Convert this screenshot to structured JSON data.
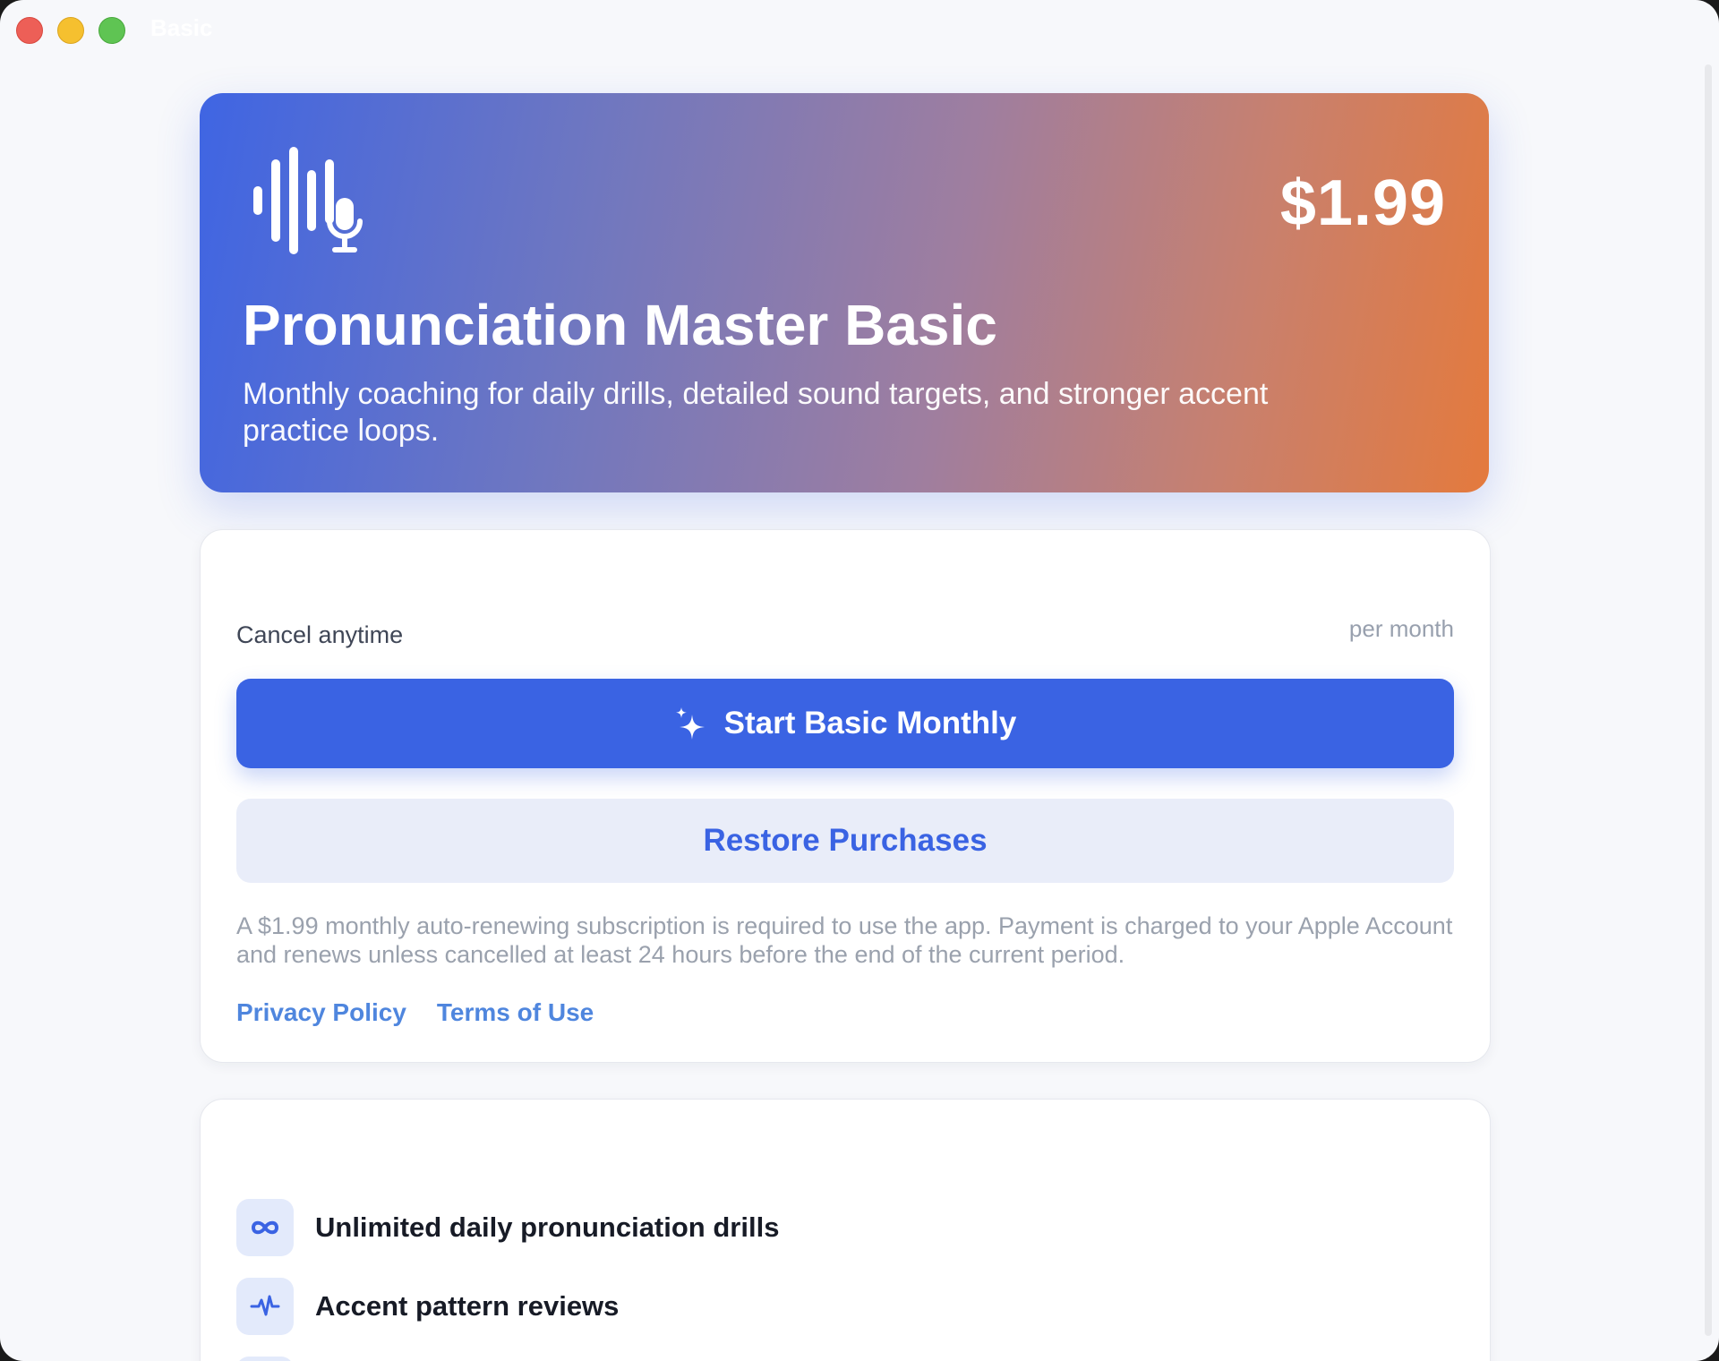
{
  "window": {
    "title": "Basic"
  },
  "hero": {
    "price": "$1.99",
    "title": "Pronunciation Master Basic",
    "subtitle": "Monthly coaching for daily drills, detailed sound targets, and stronger accent practice loops.",
    "logo_icon": "waveform-mic-icon"
  },
  "purchase": {
    "cancel_note": "Cancel anytime",
    "period": "per month",
    "primary_button": "Start Basic Monthly",
    "primary_icon": "sparkles-icon",
    "secondary_button": "Restore Purchases",
    "fine_print": "A $1.99 monthly auto-renewing subscription is required to use the app. Payment is charged to your Apple Account and renews unless cancelled at least 24 hours before the end of the current period.",
    "links": {
      "privacy": "Privacy Policy",
      "terms": "Terms of Use"
    }
  },
  "features": [
    {
      "icon": "infinity-icon",
      "label": "Unlimited daily pronunciation drills"
    },
    {
      "icon": "waveform-pulse-icon",
      "label": "Accent pattern reviews"
    }
  ],
  "colors": {
    "accent": "#3a63e3",
    "hero_gradient_start": "#3f65e3",
    "hero_gradient_end": "#e47a3d",
    "link": "#4f86de"
  }
}
